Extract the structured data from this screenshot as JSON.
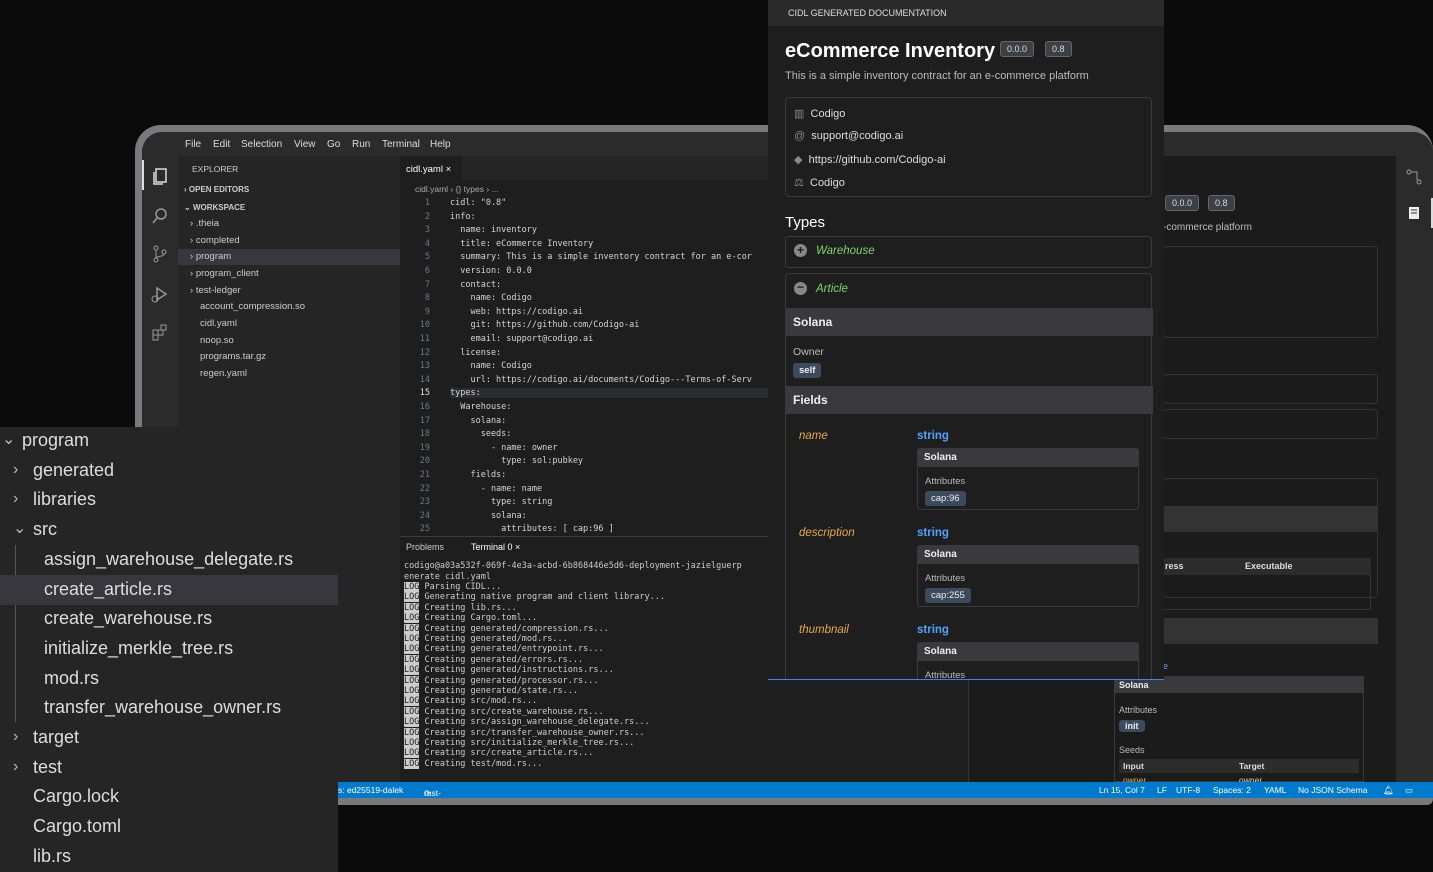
{
  "menu": [
    "File",
    "Edit",
    "Selection",
    "View",
    "Go",
    "Run",
    "Terminal",
    "Help"
  ],
  "explorer": {
    "title": "EXPLORER",
    "open_editors": "OPEN EDITORS",
    "workspace": "WORKSPACE",
    "items": [
      ".theia",
      "completed",
      "program",
      "program_client",
      "test-ledger",
      "account_compression.so",
      "cidl.yaml",
      "noop.so",
      "programs.tar.gz",
      "regen.yaml"
    ]
  },
  "editor": {
    "tab": "cidl.yaml",
    "breadcrumb": [
      "cidl.yaml",
      "{} types",
      "..."
    ],
    "lines": [
      [
        "1",
        "cidl: \"0.8\""
      ],
      [
        "2",
        "info:"
      ],
      [
        "3",
        "  name: inventory"
      ],
      [
        "4",
        "  title: eCommerce Inventory"
      ],
      [
        "5",
        "  summary: This is a simple inventory contract for an e-cor"
      ],
      [
        "6",
        "  version: 0.0.0"
      ],
      [
        "7",
        "  contact:"
      ],
      [
        "8",
        "    name: Codigo"
      ],
      [
        "9",
        "    web: https://codigo.ai"
      ],
      [
        "10",
        "    git: https://github.com/Codigo-ai"
      ],
      [
        "11",
        "    email: support@codigo.ai"
      ],
      [
        "12",
        "  license:"
      ],
      [
        "13",
        "    name: Codigo"
      ],
      [
        "14",
        "    url: https://codigo.ai/documents/Codigo---Terms-of-Serv"
      ],
      [
        "15",
        "types:"
      ],
      [
        "16",
        "  Warehouse:"
      ],
      [
        "17",
        "    solana:"
      ],
      [
        "18",
        "      seeds:"
      ],
      [
        "19",
        "        - name: owner"
      ],
      [
        "20",
        "          type: sol:pubkey"
      ],
      [
        "21",
        "    fields:"
      ],
      [
        "22",
        "      - name: name"
      ],
      [
        "23",
        "        type: string"
      ],
      [
        "24",
        "        solana:"
      ],
      [
        "25",
        "          attributes: [ cap:96 ]"
      ]
    ]
  },
  "panel": {
    "tabs": [
      "Problems",
      "Terminal 0"
    ],
    "prompt": "codigo@a03a532f-069f-4e3a-acbd-6b868446e5d6-deployment-jazielguerp",
    "cmd": "enerate cidl.yaml",
    "log_tag": "LOG",
    "logs": [
      "Parsing CIDL...",
      "Generating native program and client library...",
      "Creating lib.rs...",
      "Creating Cargo.toml...",
      "Creating generated/compression.rs...",
      "Creating generated/mod.rs...",
      "Creating generated/entrypoint.rs...",
      "Creating generated/errors.rs...",
      "Creating generated/instructions.rs...",
      "Creating generated/processor.rs...",
      "Creating generated/state.rs...",
      "Creating src/mod.rs...",
      "Creating src/create_warehouse.rs...",
      "Creating src/assign_warehouse_delegate.rs...",
      "Creating src/transfer_warehouse_owner.rs...",
      "Creating src/initialize_merkle_tree.rs...",
      "Creating src/create_article.rs...",
      "Creating test/mod.rs..."
    ]
  },
  "status": {
    "left1": "s: ed25519-dalek",
    "left2": "rust-analyzer",
    "right": [
      "Ln 15, Col 7",
      "LF",
      "UTF-8",
      "Spaces: 2",
      "YAML",
      "No JSON Schema"
    ]
  },
  "bg_preview": {
    "v1": "0.0.0",
    "v2": "0.8",
    "summary": "-commerce platform",
    "col1": "ress",
    "col2": "Executable",
    "solana": "Solana",
    "attributes": "Attributes",
    "init": "init",
    "seeds": "Seeds",
    "input": "Input",
    "target": "Target",
    "owner1": "owner",
    "owner2": "owner",
    "e": "e"
  },
  "tree": {
    "items": [
      {
        "label": "program",
        "type": "open"
      },
      {
        "label": "generated",
        "type": "closed"
      },
      {
        "label": "libraries",
        "type": "closed"
      },
      {
        "label": "src",
        "type": "open"
      },
      {
        "label": "assign_warehouse_delegate.rs",
        "type": "file"
      },
      {
        "label": "create_article.rs",
        "type": "file"
      },
      {
        "label": "create_warehouse.rs",
        "type": "file"
      },
      {
        "label": "initialize_merkle_tree.rs",
        "type": "file"
      },
      {
        "label": "mod.rs",
        "type": "file"
      },
      {
        "label": "transfer_warehouse_owner.rs",
        "type": "file"
      },
      {
        "label": "target",
        "type": "closed"
      },
      {
        "label": "test",
        "type": "closed"
      },
      {
        "label": "Cargo.lock",
        "type": "root"
      },
      {
        "label": "Cargo.toml",
        "type": "root"
      },
      {
        "label": "lib.rs",
        "type": "root"
      }
    ]
  },
  "doc": {
    "header": "CIDL GENERATED DOCUMENTATION",
    "title": "eCommerce Inventory",
    "version": "0.0.0",
    "cidl_version": "0.8",
    "summary": "This is a simple inventory contract for an e-commerce platform",
    "contact": [
      "Codigo",
      "support@codigo.ai",
      "https://github.com/Codigo-ai",
      "Codigo"
    ],
    "types_heading": "Types",
    "warehouse": "Warehouse",
    "article": "Article",
    "solana": "Solana",
    "owner_label": "Owner",
    "owner_value": "self",
    "fields": "Fields",
    "field_list": [
      {
        "name": "name",
        "type": "string",
        "cap": "cap:96"
      },
      {
        "name": "description",
        "type": "string",
        "cap": "cap:255"
      },
      {
        "name": "thumbnail",
        "type": "string",
        "cap": ""
      }
    ],
    "attributes": "Attributes"
  },
  "colors": {
    "accent": "#007acc",
    "field_name": "#e8a84c",
    "field_type": "#4fa3ff"
  }
}
